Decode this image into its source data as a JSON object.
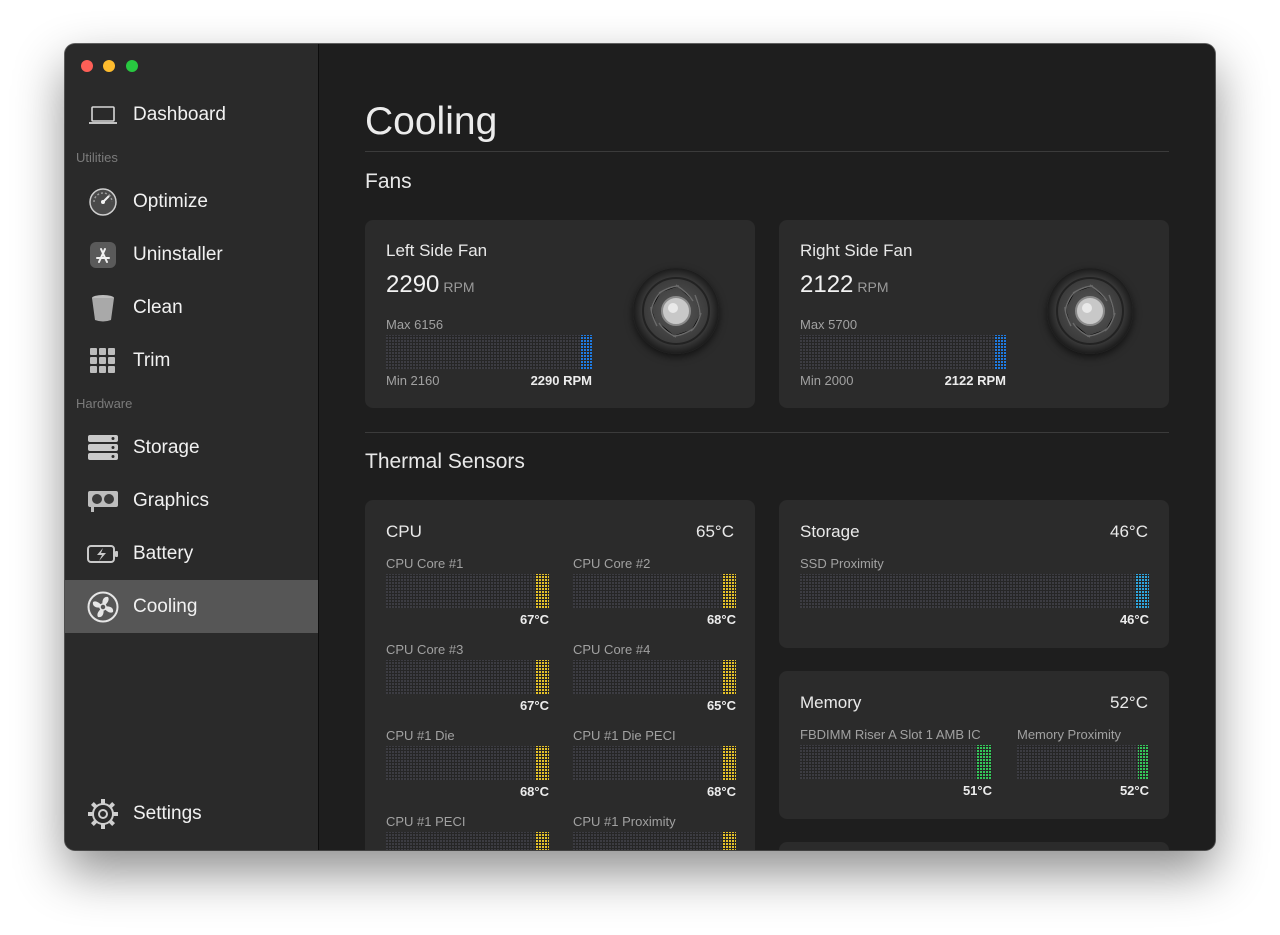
{
  "window": {
    "traffic_lights": {
      "red": "#fe5f57",
      "yellow": "#febc2e",
      "green": "#28c840"
    }
  },
  "sidebar": {
    "dashboard": {
      "label": "Dashboard",
      "icon": "laptop-icon"
    },
    "groups": [
      {
        "label": "Utilities",
        "items": [
          {
            "label": "Optimize",
            "icon": "gauge-icon"
          },
          {
            "label": "Uninstaller",
            "icon": "app-store-icon"
          },
          {
            "label": "Clean",
            "icon": "trash-can-icon"
          },
          {
            "label": "Trim",
            "icon": "grid-icon"
          }
        ]
      },
      {
        "label": "Hardware",
        "items": [
          {
            "label": "Storage",
            "icon": "server-icon"
          },
          {
            "label": "Graphics",
            "icon": "graphics-card-icon"
          },
          {
            "label": "Battery",
            "icon": "battery-icon"
          },
          {
            "label": "Cooling",
            "icon": "fan-icon",
            "active": true
          }
        ]
      }
    ],
    "settings": {
      "label": "Settings",
      "icon": "gear-icon"
    }
  },
  "main": {
    "title": "Cooling",
    "fans_section": {
      "title": "Fans",
      "fans": [
        {
          "name": "Left Side Fan",
          "rpm": "2290",
          "unit": "RPM",
          "max": "Max 6156",
          "min": "Min 2160",
          "current": "2290 RPM",
          "level": 0.06,
          "color": "#1f7ae0"
        },
        {
          "name": "Right Side Fan",
          "rpm": "2122",
          "unit": "RPM",
          "max": "Max 5700",
          "min": "Min 2000",
          "current": "2122 RPM",
          "level": 0.06,
          "color": "#1f7ae0"
        }
      ]
    },
    "thermal_section": {
      "title": "Thermal Sensors",
      "cpu": {
        "title": "CPU",
        "total": "65°C",
        "sensors": [
          {
            "name": "CPU Core #1",
            "value": "67°C",
            "level": 0.08
          },
          {
            "name": "CPU Core #2",
            "value": "68°C",
            "level": 0.08
          },
          {
            "name": "CPU Core #3",
            "value": "67°C",
            "level": 0.08
          },
          {
            "name": "CPU Core #4",
            "value": "65°C",
            "level": 0.08
          },
          {
            "name": "CPU #1 Die",
            "value": "68°C",
            "level": 0.08
          },
          {
            "name": "CPU #1 Die PECI",
            "value": "68°C",
            "level": 0.08
          },
          {
            "name": "CPU #1 PECI",
            "value": "",
            "level": 0.08
          },
          {
            "name": "CPU #1 Proximity",
            "value": "",
            "level": 0.08
          }
        ],
        "color": "#e6c229"
      },
      "storage": {
        "title": "Storage",
        "total": "46°C",
        "sensors": [
          {
            "name": "SSD Proximity",
            "value": "46°C",
            "level": 0.04
          }
        ],
        "color": "#2ea7e0"
      },
      "memory": {
        "title": "Memory",
        "total": "52°C",
        "sensors": [
          {
            "name": "FBDIMM Riser A Slot 1 AMB IC",
            "value": "51°C",
            "level": 0.08
          },
          {
            "name": "Memory Proximity",
            "value": "52°C",
            "level": 0.08
          }
        ],
        "color": "#34c759"
      }
    }
  }
}
